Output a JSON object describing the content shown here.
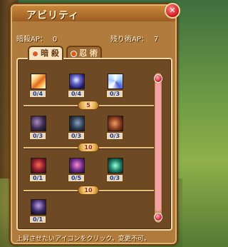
{
  "window": {
    "title": "アビリティ",
    "close_label": "✕"
  },
  "points": {
    "assassin_label": "暗殺AP：",
    "assassin_value": "0",
    "ninja_label": "残り術AP：",
    "ninja_value": "7"
  },
  "tabs": [
    {
      "label": "暗 殺",
      "active": true
    },
    {
      "label": "忍 術",
      "active": false
    }
  ],
  "skills": [
    {
      "icon": "sword-icon",
      "level": "0/4"
    },
    {
      "icon": "ninja-icon",
      "level": "0/4"
    },
    {
      "icon": "swirl-icon",
      "level": "0/3"
    },
    {
      "icon": "shadow-icon",
      "level": "0/3"
    },
    {
      "icon": "dark-icon",
      "level": "0/3"
    },
    {
      "icon": "fire-icon",
      "level": "0/3"
    },
    {
      "icon": "red-burst-icon",
      "level": "0/1"
    },
    {
      "icon": "purple-orb-icon",
      "level": "0/5"
    },
    {
      "icon": "teal-burst-icon",
      "level": "0/3"
    },
    {
      "icon": "mask-icon",
      "level": "0/1"
    }
  ],
  "tier_markers": [
    "5",
    "10",
    "10"
  ],
  "hint": "上昇させたいアイコンをクリック。変更不可。",
  "colors": {
    "panel": "#b07c3e",
    "border": "#6b3f12",
    "accent": "#d8202a"
  }
}
